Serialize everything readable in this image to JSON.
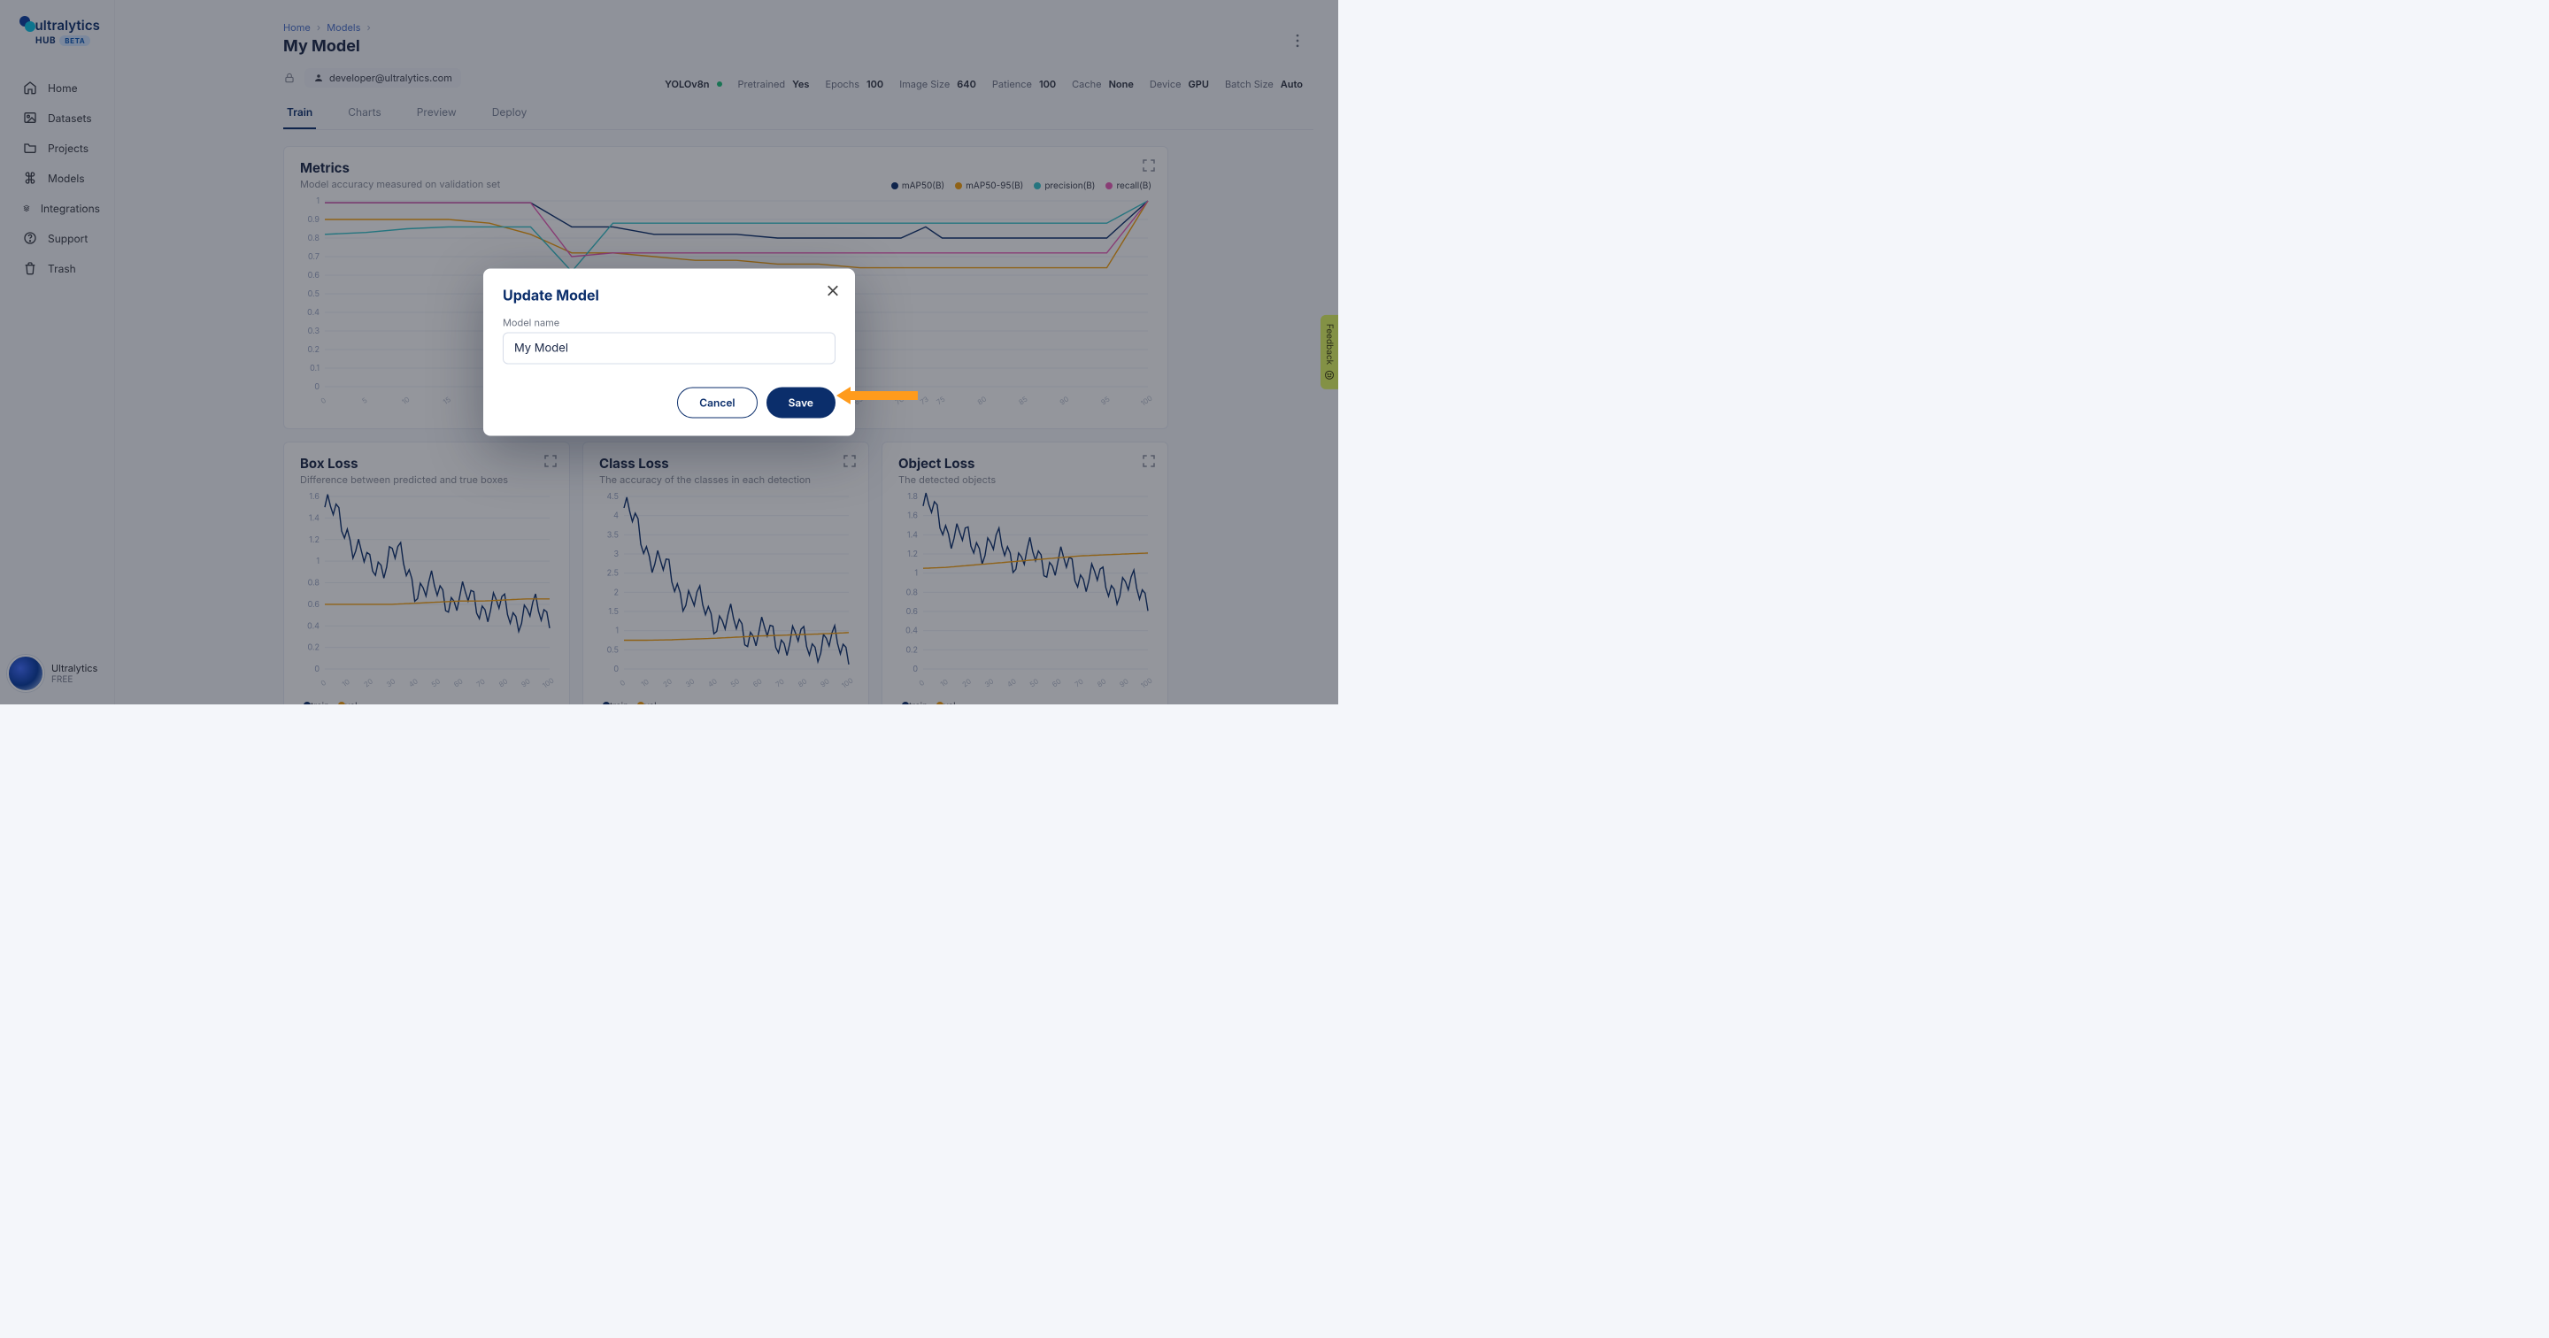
{
  "brand": {
    "name": "ultralytics",
    "hub": "HUB",
    "beta": "BETA"
  },
  "sidebar": {
    "items": [
      {
        "label": "Home",
        "icon": "home"
      },
      {
        "label": "Datasets",
        "icon": "image"
      },
      {
        "label": "Projects",
        "icon": "folder"
      },
      {
        "label": "Models",
        "icon": "command"
      },
      {
        "label": "Integrations",
        "icon": "layers"
      },
      {
        "label": "Support",
        "icon": "help"
      },
      {
        "label": "Trash",
        "icon": "trash"
      }
    ],
    "user": {
      "name": "Ultralytics",
      "plan": "FREE"
    }
  },
  "feedback_label": "Feedback",
  "breadcrumbs": {
    "home": "Home",
    "models": "Models"
  },
  "page": {
    "title": "My Model",
    "owner": "developer@ultralytics.com"
  },
  "meta": {
    "framework": "YOLOv8n",
    "pairs": [
      {
        "lbl": "Pretrained",
        "val": "Yes"
      },
      {
        "lbl": "Epochs",
        "val": "100"
      },
      {
        "lbl": "Image Size",
        "val": "640"
      },
      {
        "lbl": "Patience",
        "val": "100"
      },
      {
        "lbl": "Cache",
        "val": "None"
      },
      {
        "lbl": "Device",
        "val": "GPU"
      },
      {
        "lbl": "Batch Size",
        "val": "Auto"
      }
    ]
  },
  "tabs": [
    "Train",
    "Charts",
    "Preview",
    "Deploy"
  ],
  "active_tab": 0,
  "cards": {
    "metrics": {
      "title": "Metrics",
      "sub": "Model accuracy measured on validation set",
      "legend": [
        {
          "name": "mAP50(B)",
          "color": "#0b2e6b"
        },
        {
          "name": "mAP50-95(B)",
          "color": "#f59e0b"
        },
        {
          "name": "precision(B)",
          "color": "#33c1c9"
        },
        {
          "name": "recall(B)",
          "color": "#e95bb6"
        }
      ]
    },
    "box": {
      "title": "Box Loss",
      "sub": "Difference between predicted and true boxes"
    },
    "class": {
      "title": "Class Loss",
      "sub": "The accuracy of the classes in each detection"
    },
    "object": {
      "title": "Object Loss",
      "sub": "The detected objects"
    },
    "loss_legend": [
      {
        "name": "train",
        "color": "#0b2e6b"
      },
      {
        "name": "val",
        "color": "#f59e0b"
      }
    ]
  },
  "modal": {
    "title": "Update Model",
    "field_label": "Model name",
    "value": "My Model",
    "cancel": "Cancel",
    "save": "Save"
  },
  "chart_data": [
    {
      "type": "line",
      "title": "Metrics",
      "xlabel": "",
      "ylabel": "",
      "ylim": [
        0,
        1.0
      ],
      "y_ticks": [
        0,
        0.1,
        0.2,
        0.3,
        0.4,
        0.5,
        0.6,
        0.7,
        0.8,
        0.9,
        1.0
      ],
      "x": [
        0,
        5,
        10,
        15,
        20,
        25,
        30,
        35,
        40,
        45,
        50,
        55,
        60,
        65,
        70,
        73,
        75,
        80,
        85,
        90,
        95,
        100
      ],
      "series": [
        {
          "name": "mAP50(B)",
          "color": "#0b2e6b",
          "values": [
            0.99,
            0.99,
            0.99,
            0.99,
            0.99,
            0.99,
            0.86,
            0.86,
            0.82,
            0.82,
            0.82,
            0.8,
            0.8,
            0.8,
            0.8,
            0.86,
            0.8,
            0.8,
            0.8,
            0.8,
            0.8,
            1.0
          ]
        },
        {
          "name": "mAP50-95(B)",
          "color": "#f59e0b",
          "values": [
            0.9,
            0.9,
            0.9,
            0.9,
            0.88,
            0.82,
            0.72,
            0.72,
            0.7,
            0.68,
            0.68,
            0.66,
            0.66,
            0.64,
            0.64,
            0.64,
            0.64,
            0.64,
            0.64,
            0.64,
            0.64,
            1.0
          ]
        },
        {
          "name": "precision(B)",
          "color": "#33c1c9",
          "values": [
            0.82,
            0.83,
            0.85,
            0.86,
            0.86,
            0.86,
            0.62,
            0.88,
            0.88,
            0.88,
            0.88,
            0.88,
            0.88,
            0.88,
            0.88,
            0.88,
            0.88,
            0.88,
            0.88,
            0.88,
            0.88,
            1.0
          ]
        },
        {
          "name": "recall(B)",
          "color": "#e95bb6",
          "values": [
            0.99,
            0.99,
            0.99,
            0.99,
            0.99,
            0.99,
            0.7,
            0.72,
            0.72,
            0.72,
            0.72,
            0.72,
            0.72,
            0.72,
            0.72,
            0.72,
            0.72,
            0.72,
            0.72,
            0.72,
            0.72,
            1.0
          ]
        }
      ]
    },
    {
      "type": "line",
      "title": "Box Loss",
      "xlabel": "",
      "ylabel": "",
      "ylim": [
        0,
        1.6
      ],
      "y_ticks": [
        0,
        0.2,
        0.4,
        0.6,
        0.8,
        1.0,
        1.2,
        1.4,
        1.6
      ],
      "x": [
        0,
        10,
        20,
        30,
        40,
        50,
        60,
        70,
        80,
        90,
        100
      ],
      "series": [
        {
          "name": "train",
          "color": "#0b2e6b",
          "values": [
            1.5,
            1.3,
            0.9,
            1.1,
            0.8,
            0.7,
            0.65,
            0.6,
            0.55,
            0.5,
            0.55
          ]
        },
        {
          "name": "val",
          "color": "#f59e0b",
          "values": [
            0.6,
            0.6,
            0.6,
            0.6,
            0.61,
            0.62,
            0.63,
            0.63,
            0.64,
            0.65,
            0.65
          ]
        }
      ]
    },
    {
      "type": "line",
      "title": "Class Loss",
      "xlabel": "",
      "ylabel": "",
      "ylim": [
        0,
        4.5
      ],
      "y_ticks": [
        0,
        0.5,
        1.0,
        1.5,
        2.0,
        2.5,
        3.0,
        3.5,
        4.0,
        4.5
      ],
      "x": [
        0,
        10,
        20,
        30,
        40,
        50,
        60,
        70,
        80,
        90,
        100
      ],
      "series": [
        {
          "name": "train",
          "color": "#0b2e6b",
          "values": [
            4.2,
            3.2,
            2.4,
            1.8,
            1.4,
            1.1,
            0.9,
            0.8,
            0.7,
            0.65,
            0.6
          ]
        },
        {
          "name": "val",
          "color": "#f59e0b",
          "values": [
            0.75,
            0.75,
            0.76,
            0.78,
            0.8,
            0.83,
            0.86,
            0.88,
            0.9,
            0.92,
            0.95
          ]
        }
      ]
    },
    {
      "type": "line",
      "title": "Object Loss",
      "xlabel": "",
      "ylabel": "",
      "ylim": [
        0,
        1.8
      ],
      "y_ticks": [
        0,
        0.2,
        0.4,
        0.6,
        0.8,
        1.0,
        1.2,
        1.4,
        1.6,
        1.8
      ],
      "x": [
        0,
        10,
        20,
        30,
        40,
        50,
        60,
        70,
        80,
        90,
        100
      ],
      "series": [
        {
          "name": "train",
          "color": "#0b2e6b",
          "values": [
            1.7,
            1.5,
            1.3,
            1.3,
            1.2,
            1.15,
            1.1,
            1.0,
            0.9,
            0.85,
            0.8
          ]
        },
        {
          "name": "val",
          "color": "#f59e0b",
          "values": [
            1.05,
            1.06,
            1.08,
            1.1,
            1.12,
            1.14,
            1.16,
            1.18,
            1.19,
            1.2,
            1.21
          ]
        }
      ]
    }
  ]
}
